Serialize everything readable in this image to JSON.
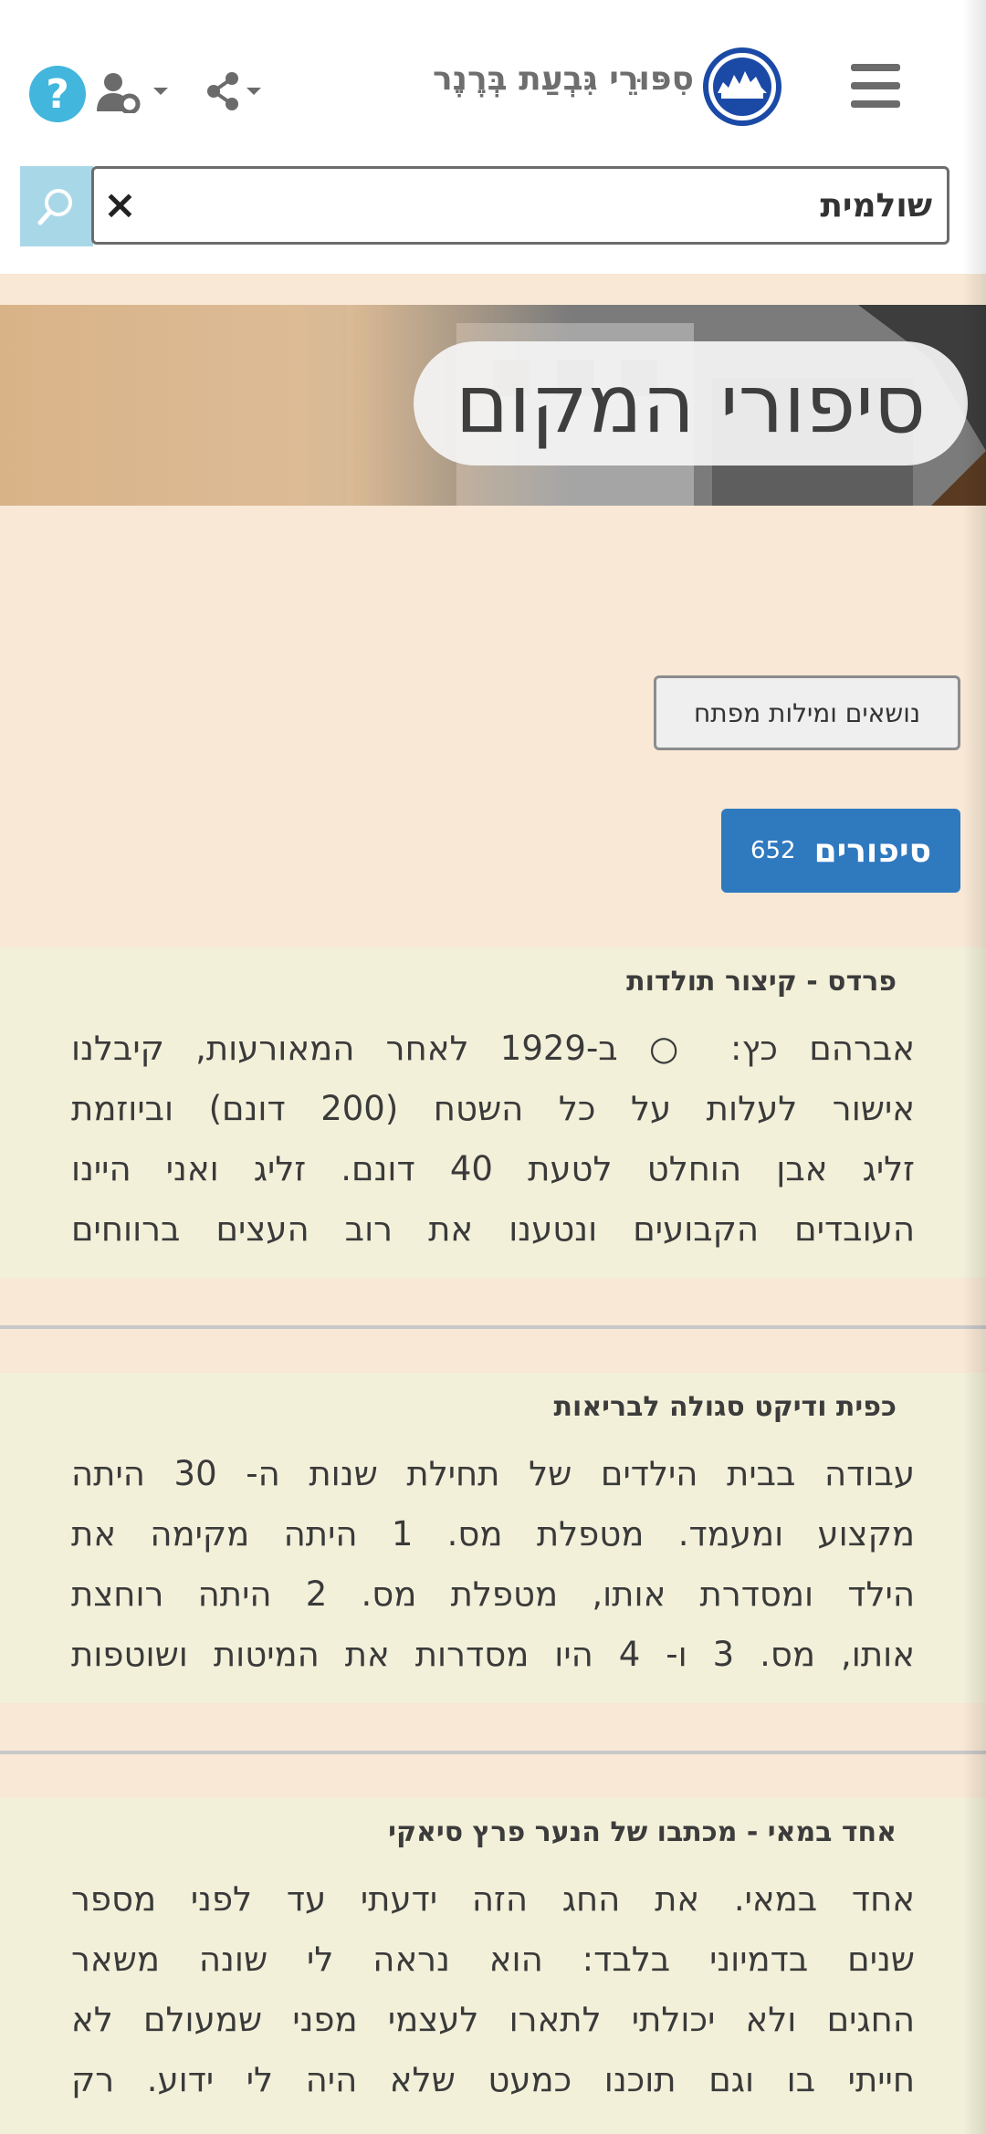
{
  "header": {
    "site_title": "סִפּוּרֵי גִּבְעַת בְּרֶנֶר",
    "search_value": "שולמית",
    "clear_symbol": "×",
    "help_symbol": "?"
  },
  "banner": {
    "title": "סיפורי המקום"
  },
  "buttons": {
    "topics_label": "נושאים ומילות מפתח",
    "stories_label": "סיפורים",
    "stories_count": "652"
  },
  "stories": [
    {
      "title": "פרדס - קיצור תולדות",
      "lines": [
        "אברהם כץ: ○ ב-1929 לאחר המאורעות, קיבלנו",
        "אישור לעלות על כל השטח (200 דונם) וביוזמת",
        "זליג אבן הוחלט לטעת 40 דונם. זליג ואני היינו",
        "העובדים הקבועים ונטענו את רוב העצים ברווחים"
      ]
    },
    {
      "title": "כפית ודיקט סגולה לבריאות",
      "lines": [
        "עבודה בבית הילדים של תחילת שנות ה- 30 היתה",
        "מקצוע ומעמד. מטפלת מס. 1 היתה מקימה את",
        "הילד ומסדרת אותו, מטפלת מס. 2 היתה רוחצת",
        "אותו, מס. 3 ו- 4 היו מסדרות את המיטות ושוטפות"
      ]
    },
    {
      "title": "אחד במאי - מכתבו של הנער פרץ סיאקי",
      "lines": [
        "אחד במאי. את החג הזה ידעתי עד לפני מספר",
        "שנים בדמיוני בלבד: הוא נראה לי שונה משאר",
        "החגים ולא יכולתי לתארו לעצמי מפני שמעולם לא",
        "חייתי בו וגם תוכנו כמעט שלא היה לי ידוע. רק"
      ]
    }
  ],
  "icons": {
    "menu": "hamburger-menu-icon",
    "logo": "site-logo",
    "share": "share-icon",
    "user_settings": "user-cog-icon",
    "help": "help-icon",
    "search": "search-icon",
    "clear": "close-icon"
  },
  "colors": {
    "page_background": "#f8e8d5",
    "story_background": "#f2f0d9",
    "primary_button": "#2f79bf",
    "help_button": "#42b6dd",
    "search_button": "#a8d8e8",
    "logo_blue": "#1b4aa6"
  }
}
